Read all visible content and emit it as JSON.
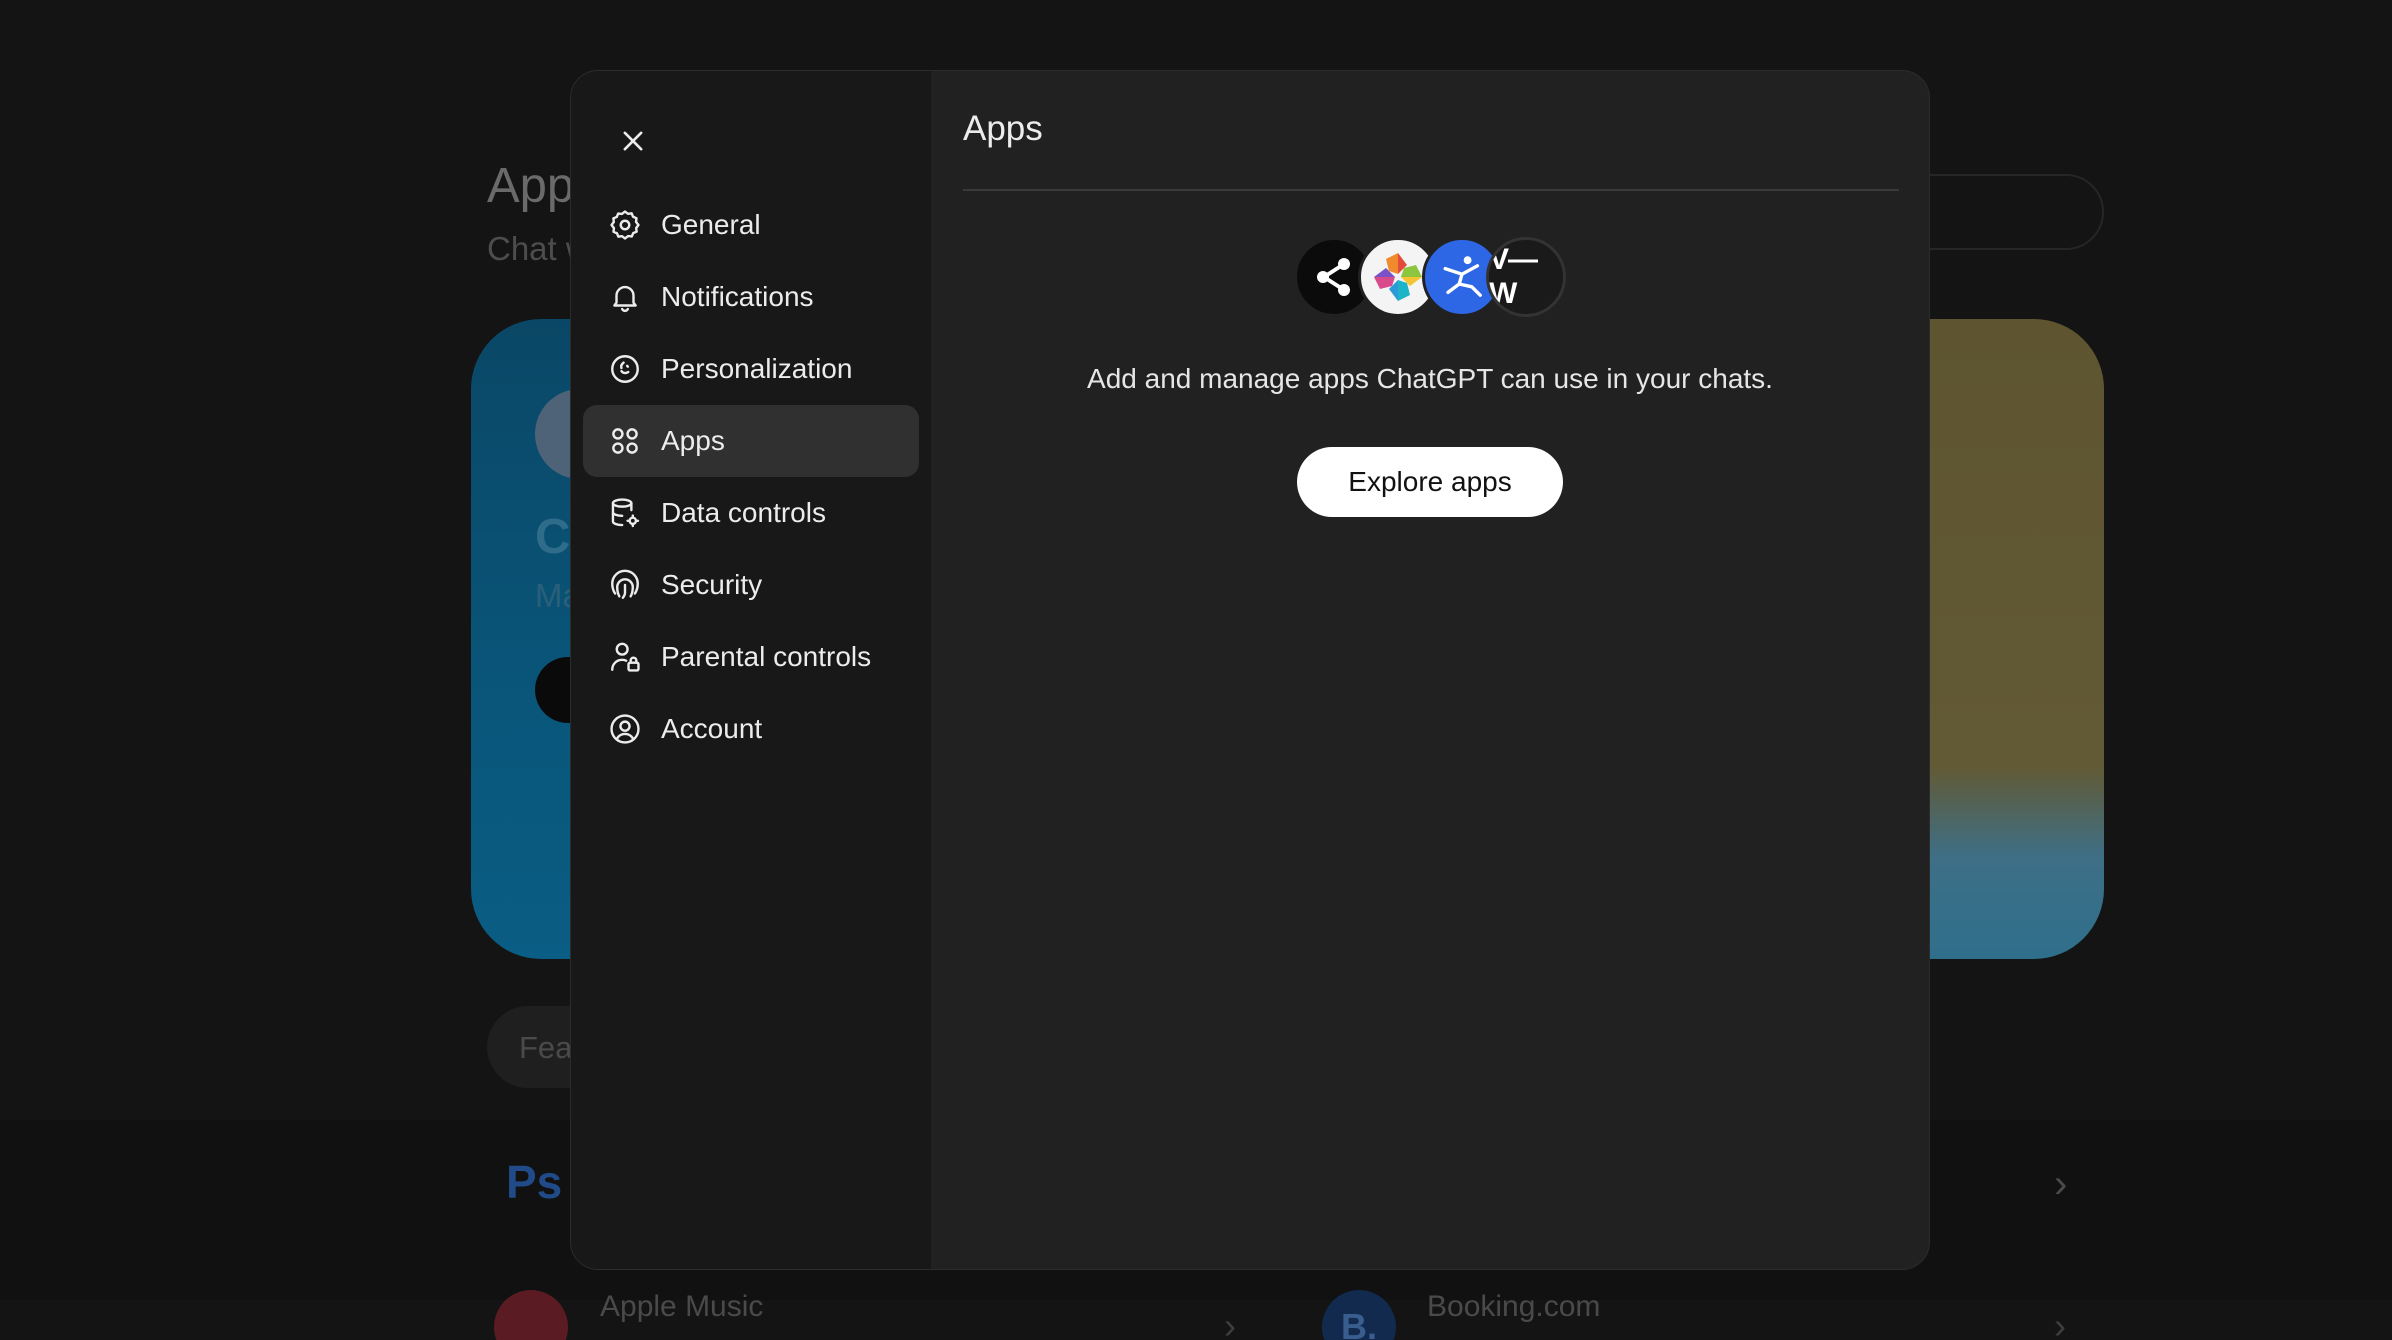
{
  "background": {
    "title": "App",
    "subtitle": "Chat w",
    "card_letter": "C",
    "card_sub": "Ma",
    "pill_label": "Feat",
    "section_logo": "Ps",
    "list": [
      {
        "name": "Apple Music"
      },
      {
        "name": "Booking.com",
        "icon_letter": "B."
      }
    ]
  },
  "modal": {
    "close_icon": "close-icon",
    "nav": [
      {
        "label": "General",
        "icon": "gear-icon"
      },
      {
        "label": "Notifications",
        "icon": "bell-icon"
      },
      {
        "label": "Personalization",
        "icon": "personalization-icon"
      },
      {
        "label": "Apps",
        "icon": "apps-grid-icon",
        "active": true
      },
      {
        "label": "Data controls",
        "icon": "database-icon"
      },
      {
        "label": "Security",
        "icon": "fingerprint-icon"
      },
      {
        "label": "Parental controls",
        "icon": "parental-icon"
      },
      {
        "label": "Account",
        "icon": "account-icon"
      }
    ],
    "content": {
      "title": "Apps",
      "description": "Add and manage apps ChatGPT can use in your chats.",
      "button_label": "Explore apps",
      "app_icons": [
        {
          "icon": "share-icon"
        },
        {
          "icon": "colorful-logo-icon"
        },
        {
          "icon": "runner-icon"
        },
        {
          "icon": "vw-logo-icon",
          "text": "V—W"
        }
      ]
    }
  }
}
